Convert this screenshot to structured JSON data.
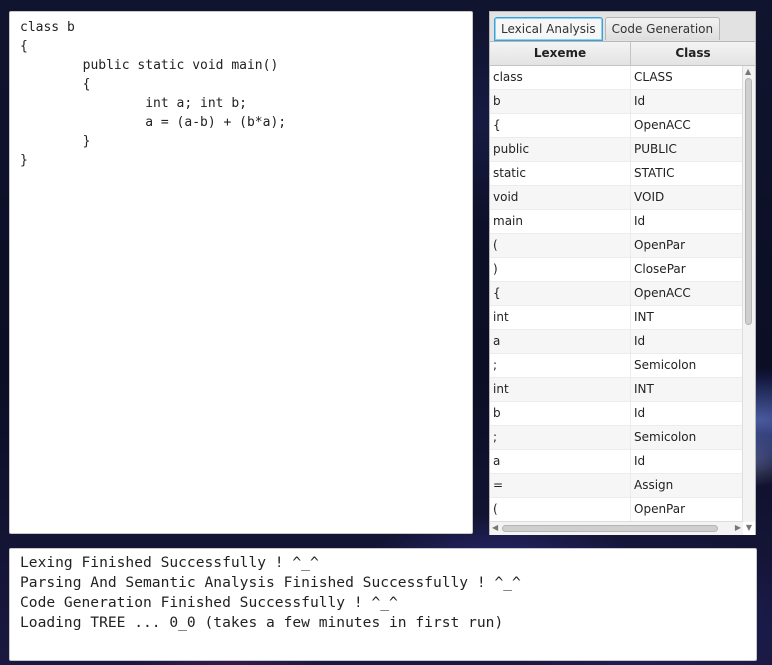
{
  "editor": {
    "code": "class b\n{\n\tpublic static void main()\n\t{\n\t\tint a; int b;\n\t\ta = (a-b) + (b*a);\n\t}\n}"
  },
  "tabs": [
    {
      "label": "Lexical Analysis",
      "active": true
    },
    {
      "label": "Code Generation",
      "active": false
    }
  ],
  "table": {
    "headers": [
      "Lexeme",
      "Class"
    ],
    "rows": [
      [
        "class",
        "CLASS"
      ],
      [
        "b",
        "Id"
      ],
      [
        "{",
        "OpenACC"
      ],
      [
        "public",
        "PUBLIC"
      ],
      [
        "static",
        "STATIC"
      ],
      [
        "void",
        "VOID"
      ],
      [
        "main",
        "Id"
      ],
      [
        "(",
        "OpenPar"
      ],
      [
        ")",
        "ClosePar"
      ],
      [
        "{",
        "OpenACC"
      ],
      [
        "int",
        "INT"
      ],
      [
        "a",
        "Id"
      ],
      [
        ";",
        "Semicolon"
      ],
      [
        "int",
        "INT"
      ],
      [
        "b",
        "Id"
      ],
      [
        ";",
        "Semicolon"
      ],
      [
        "a",
        "Id"
      ],
      [
        "=",
        "Assign"
      ],
      [
        "(",
        "OpenPar"
      ]
    ]
  },
  "console": {
    "lines": [
      "Lexing Finished Successfully ! ^_^",
      "Parsing And Semantic Analysis Finished Successfully ! ^_^",
      "Code Generation Finished Successfully ! ^_^",
      "Loading TREE ... 0_0 (takes a few minutes in first run)"
    ]
  }
}
